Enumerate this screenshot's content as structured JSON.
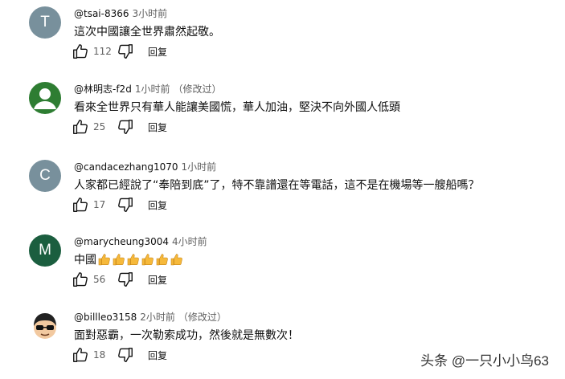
{
  "comments": [
    {
      "initial": "T",
      "author": "@tsai-8366",
      "time": "3小时前",
      "edited": "",
      "text": "這次中國讓全世界肅然起敬。",
      "likes": "112",
      "reply": "回复",
      "avatar_color": "#78909c"
    },
    {
      "initial": "",
      "author": "@林明志-f2d",
      "time": "1小时前",
      "edited": "（修改过）",
      "text": "看來全世界只有華人能讓美國慌，華人加油，堅決不向外國人低頭",
      "likes": "25",
      "reply": "回复",
      "avatar_color": "#2e7d32"
    },
    {
      "initial": "C",
      "author": "@candacezhang1070",
      "time": "1小时前",
      "edited": "",
      "text": "人家都已經說了“奉陪到底”了，特不靠譜還在等電話，這不是在機場等一艘船嗎？",
      "likes": "17",
      "reply": "回复",
      "avatar_color": "#78909c"
    },
    {
      "initial": "M",
      "author": "@marycheung3004",
      "time": "4小时前",
      "edited": "",
      "text": "中國",
      "emoji_count": 6,
      "likes": "56",
      "reply": "回复",
      "avatar_color": "#1b5e3f"
    },
    {
      "initial": "",
      "author": "@billleo3158",
      "time": "2小时前",
      "edited": "（修改过）",
      "text": "面對惡霸，一次勒索成功，然後就是無數次！",
      "likes": "18",
      "reply": "回复",
      "avatar_color": "#ffffff"
    }
  ],
  "watermark": "头条 @一只小小鸟63",
  "icons": {
    "like": "thumbs-up-icon",
    "dislike": "thumbs-down-icon",
    "emoji": "thumbs-up-emoji-icon"
  }
}
